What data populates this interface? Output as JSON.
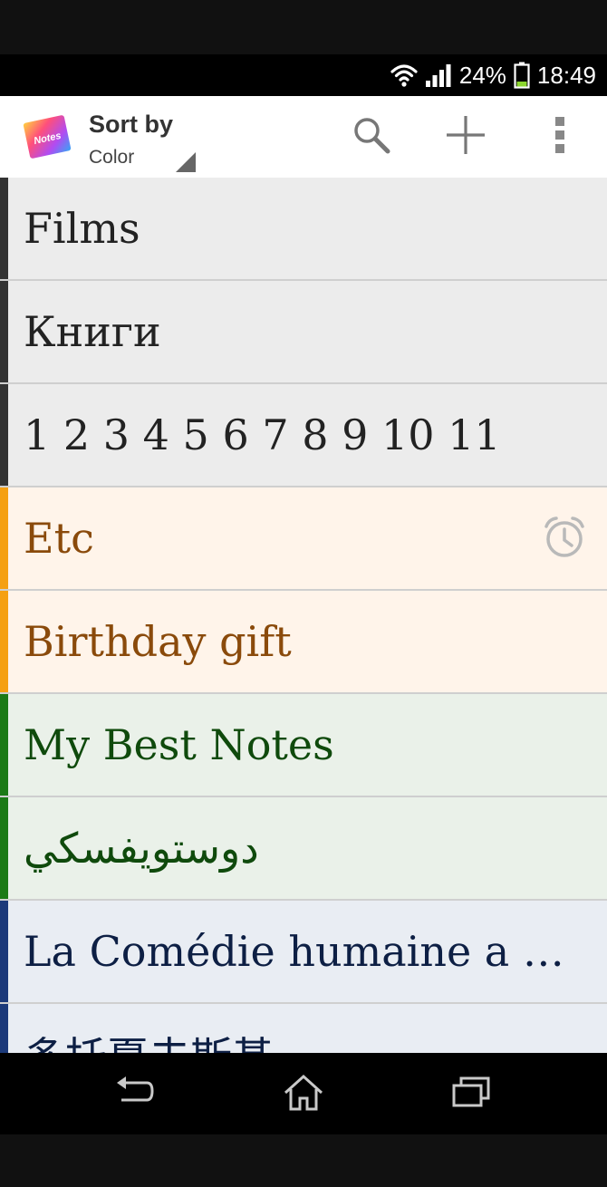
{
  "status_bar": {
    "battery_percent": "24%",
    "time": "18:49",
    "icons": [
      "wifi-icon",
      "signal-icon",
      "battery-icon"
    ],
    "battery_level": 0.24
  },
  "action_bar": {
    "app_icon": "notes-app-icon",
    "app_icon_text": "Notes",
    "sort_title": "Sort by",
    "sort_value": "Color",
    "actions": [
      "search-icon",
      "add-icon",
      "overflow-menu-icon"
    ]
  },
  "notes": [
    {
      "title": "Films",
      "color_bar": "#333333",
      "background": "#ececec",
      "text_color": "#222222",
      "alarm": false
    },
    {
      "title": "Книги",
      "color_bar": "#333333",
      "background": "#ececec",
      "text_color": "#222222",
      "alarm": false
    },
    {
      "title": "1 2 3 4 5 6 7 8 9 10 11",
      "color_bar": "#333333",
      "background": "#ececec",
      "text_color": "#222222",
      "alarm": false
    },
    {
      "title": "Etc",
      "color_bar": "#f5a012",
      "background": "#fff4ea",
      "text_color": "#8a4a0b",
      "alarm": true
    },
    {
      "title": "Birthday gift",
      "color_bar": "#f5a012",
      "background": "#fff4ea",
      "text_color": "#8a4a0b",
      "alarm": false
    },
    {
      "title": "My Best Notes",
      "color_bar": "#1c7a16",
      "background": "#eaf1e9",
      "text_color": "#0f4a0c",
      "alarm": false
    },
    {
      "title": "دوستويفسكي",
      "color_bar": "#1c7a16",
      "background": "#eaf1e9",
      "text_color": "#0f4a0c",
      "alarm": false
    },
    {
      "title": "La Comédie humaine a ét...",
      "color_bar": "#1c3a7a",
      "background": "#e9edf3",
      "text_color": "#0d1f44",
      "alarm": false
    },
    {
      "title": "多托夏夫斯基",
      "color_bar": "#1c3a7a",
      "background": "#e9edf3",
      "text_color": "#0d1f44",
      "alarm": false
    }
  ],
  "nav_bar": {
    "buttons": [
      "back-icon",
      "home-icon",
      "recent-apps-icon"
    ]
  }
}
